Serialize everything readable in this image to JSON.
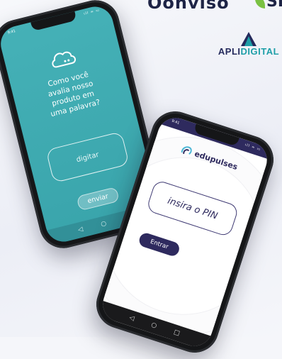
{
  "logos": {
    "oonviso": "Oonviso",
    "leaf_brand": "SI",
    "apli_prefix": "APLI",
    "apli_suffix": "DIGITAL"
  },
  "phone1": {
    "status_time": "9:41",
    "status_icons": "ıll ≈ ▭",
    "question_lines": [
      "Como você",
      "avalia nosso",
      "produto em",
      "uma palavra?"
    ],
    "input_placeholder": "digitar",
    "submit_label": "enviar",
    "nav": {
      "back": "◁",
      "home": "○",
      "recent": "□"
    }
  },
  "phone2": {
    "status_time": "9:41",
    "status_icons": "ıll ≈ ▭",
    "brand_name": "edupulses",
    "pin_placeholder": "insira o PIN",
    "enter_label": "Entrar",
    "nav": {
      "back": "◁",
      "home": "○",
      "recent": "□"
    }
  },
  "colors": {
    "teal": "#3fabb1",
    "navy": "#2e2a5e",
    "leaf_green": "#7ac143",
    "apli_teal": "#1e9fa8"
  }
}
